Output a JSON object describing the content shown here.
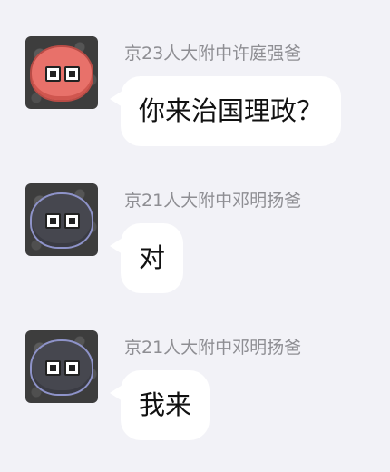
{
  "messages": [
    {
      "sender": "京23人大附中许庭强爸",
      "text": "你来治国理政？",
      "avatar_icon": "red-blob-avatar"
    },
    {
      "sender": "京21人大附中邓明扬爸",
      "text": "对",
      "avatar_icon": "gray-blob-avatar"
    },
    {
      "sender": "京21人大附中邓明扬爸",
      "text": "我来",
      "avatar_icon": "gray-blob-avatar"
    }
  ],
  "colors": {
    "background": "#f2f2f7",
    "bubble": "#ffffff",
    "sender_name": "#8e8e93",
    "avatar_red": "#e8716a",
    "avatar_gray": "#46474f"
  }
}
